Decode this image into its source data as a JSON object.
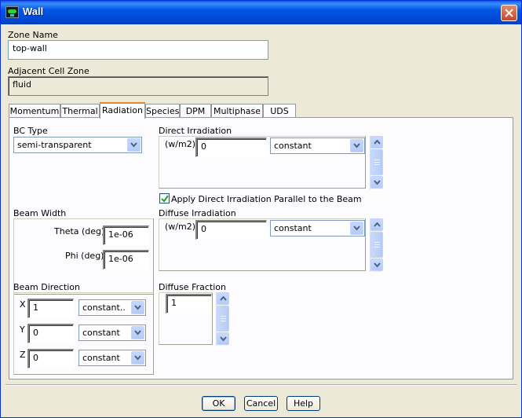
{
  "window": {
    "title": "Wall"
  },
  "zone": {
    "zone_name_label": "Zone Name",
    "zone_name_value": "top-wall",
    "adjacent_label": "Adjacent Cell Zone",
    "adjacent_value": "fluid"
  },
  "tabs": [
    {
      "label": "Momentum"
    },
    {
      "label": "Thermal"
    },
    {
      "label": "Radiation"
    },
    {
      "label": "Species"
    },
    {
      "label": "DPM"
    },
    {
      "label": "Multiphase"
    },
    {
      "label": "UDS"
    }
  ],
  "active_tab": "Radiation",
  "radiation": {
    "bc_type_label": "BC Type",
    "bc_type_value": "semi-transparent",
    "direct_irradiation_label": "Direct Irradiation",
    "direct_unit": "(w/m2)",
    "direct_value": "0",
    "direct_method": "constant",
    "parallel_checkbox_label": "Apply Direct Irradiation Parallel to the Beam",
    "parallel_checked": true,
    "beam_width_label": "Beam Width",
    "theta_label": "Theta (deg)",
    "theta_value": "1e-06",
    "phi_label": "Phi (deg)",
    "phi_value": "1e-06",
    "diffuse_irradiation_label": "Diffuse Irradiation",
    "diffuse_unit": "(w/m2)",
    "diffuse_value": "0",
    "diffuse_method": "constant",
    "beam_direction_label": "Beam Direction",
    "beam_x_label": "X",
    "beam_x_value": "1",
    "beam_x_method": "constant...",
    "beam_y_label": "Y",
    "beam_y_value": "0",
    "beam_y_method": "constant",
    "beam_z_label": "Z",
    "beam_z_value": "0",
    "beam_z_method": "constant",
    "diffuse_fraction_label": "Diffuse Fraction",
    "diffuse_fraction_value": "1"
  },
  "buttons": {
    "ok": "OK",
    "cancel": "Cancel",
    "help": "Help"
  },
  "colors": {
    "titlebar": "#0055e5",
    "dialog_bg": "#ece9d8",
    "active_tab_accent": "#e68b2c"
  },
  "icons": [
    "app-icon",
    "close-icon",
    "chevron-down-icon",
    "arrow-up-icon",
    "arrow-down-icon",
    "checkmark-icon"
  ]
}
